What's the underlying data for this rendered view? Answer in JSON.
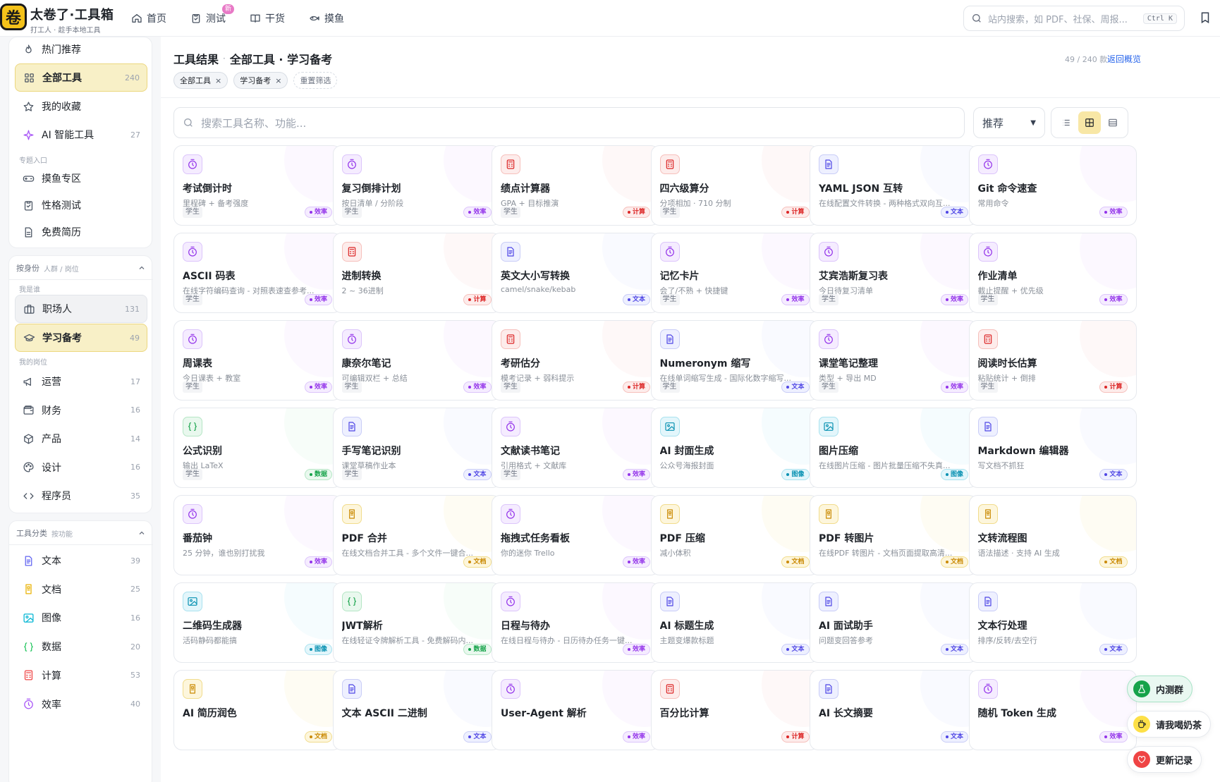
{
  "header": {
    "logo_char": "卷",
    "brand_title": "太卷了·工具箱",
    "brand_sub": "打工人 · 趁手本地工具",
    "nav": [
      {
        "label": "首页",
        "icon": "home-icon"
      },
      {
        "label": "测试",
        "icon": "clipboard-icon",
        "badge": "新"
      },
      {
        "label": "干货",
        "icon": "book-icon"
      },
      {
        "label": "摸鱼",
        "icon": "fish-icon"
      }
    ],
    "search_placeholder": "站内搜索，如 PDF、社保、周报...",
    "search_kbd": "Ctrl K"
  },
  "sidebar": {
    "top_items": [
      {
        "label": "热门推荐",
        "icon": "fire-icon",
        "count": ""
      },
      {
        "label": "全部工具",
        "icon": "grid-icon",
        "count": "240",
        "active": true
      },
      {
        "label": "我的收藏",
        "icon": "star-icon",
        "count": ""
      },
      {
        "label": "AI 智能工具",
        "icon": "sparkle-icon",
        "count": "27"
      }
    ],
    "special_label": "专题入口",
    "special_items": [
      {
        "label": "摸鱼专区",
        "icon": "gamepad-icon"
      },
      {
        "label": "性格测试",
        "icon": "clipboard-icon"
      },
      {
        "label": "免费简历",
        "icon": "document-icon"
      }
    ],
    "identity_head": "按身份",
    "identity_sub": "人群 / 岗位",
    "i_am_label": "我是谁",
    "identity_items": [
      {
        "label": "职场人",
        "icon": "briefcase-icon",
        "count": "131"
      },
      {
        "label": "学习备考",
        "icon": "graduation-icon",
        "count": "49",
        "active": true
      }
    ],
    "role_label": "我的岗位",
    "role_items": [
      {
        "label": "运营",
        "icon": "megaphone-icon",
        "count": "17"
      },
      {
        "label": "财务",
        "icon": "wallet-icon",
        "count": "16"
      },
      {
        "label": "产品",
        "icon": "box-icon",
        "count": "14"
      },
      {
        "label": "设计",
        "icon": "palette-icon",
        "count": "16"
      },
      {
        "label": "程序员",
        "icon": "code-icon",
        "count": "35"
      }
    ],
    "category_head": "工具分类",
    "category_sub": "按功能",
    "category_items": [
      {
        "label": "文本",
        "icon": "text-file-icon",
        "count": "39",
        "color": "#6366f1"
      },
      {
        "label": "文档",
        "icon": "doc-icon",
        "count": "25",
        "color": "#eab308"
      },
      {
        "label": "图像",
        "icon": "image-icon",
        "count": "16",
        "color": "#06b6d4"
      },
      {
        "label": "数据",
        "icon": "braces-icon",
        "count": "20",
        "color": "#22c55e"
      },
      {
        "label": "计算",
        "icon": "calculator-icon",
        "count": "53",
        "color": "#ef4444"
      },
      {
        "label": "效率",
        "icon": "timer-icon",
        "count": "40",
        "color": "#a855f7"
      }
    ]
  },
  "main": {
    "title_a": "工具结果",
    "title_sep": "·",
    "title_b": "全部工具 · 学习备考",
    "counter": "49 / 240 款",
    "back": "返回概览",
    "chips": [
      "全部工具",
      "学习备考"
    ],
    "chip_close": "×",
    "reset": "重置筛选",
    "search_placeholder": "搜索工具名称、功能...",
    "sort": "推荐"
  },
  "colors": {
    "效率": {
      "fg": "#9333ea",
      "bg": "#f5ecff",
      "bd": "#dcc5fb",
      "icon": "timer-icon"
    },
    "计算": {
      "fg": "#dc2626",
      "bg": "#fdeceb",
      "bd": "#f6c0bc",
      "icon": "calculator-icon"
    },
    "文本": {
      "fg": "#4f46e5",
      "bg": "#eef0ff",
      "bd": "#c9cdf7",
      "icon": "text-file-icon"
    },
    "数据": {
      "fg": "#16a34a",
      "bg": "#e9f8ee",
      "bd": "#b5e6c5",
      "icon": "braces-icon"
    },
    "图像": {
      "fg": "#0891b2",
      "bg": "#e3f6fb",
      "bd": "#a9e2ef",
      "icon": "image-icon"
    },
    "文档": {
      "fg": "#ca8a04",
      "bg": "#fdf6dc",
      "bd": "#f1dc8c",
      "icon": "doc-icon"
    }
  },
  "tools": [
    {
      "name": "考试倒计时",
      "desc": "里程碑 + 备考强度",
      "aud": "学生",
      "tag": "效率"
    },
    {
      "name": "复习倒排计划",
      "desc": "按日清单 / 分阶段",
      "aud": "学生",
      "tag": "效率"
    },
    {
      "name": "绩点计算器",
      "desc": "GPA + 目标推演",
      "aud": "学生",
      "tag": "计算"
    },
    {
      "name": "四六级算分",
      "desc": "分项相加 · 710 分制",
      "aud": "学生",
      "tag": "计算"
    },
    {
      "name": "YAML JSON 互转",
      "desc": "在线配置文件转换 - 两种格式双向互...",
      "aud": "",
      "tag": "文本"
    },
    {
      "name": "Git 命令速查",
      "desc": "常用命令",
      "aud": "",
      "tag": "效率"
    },
    {
      "name": "ASCII 码表",
      "desc": "在线字符编码查询 - 对照表速查参考...",
      "aud": "学生",
      "tag": "效率"
    },
    {
      "name": "进制转换",
      "desc": "2 ~ 36进制",
      "aud": "",
      "tag": "计算"
    },
    {
      "name": "英文大小写转换",
      "desc": "camel/snake/kebab",
      "aud": "",
      "tag": "文本"
    },
    {
      "name": "记忆卡片",
      "desc": "会了/不熟 + 快捷键",
      "aud": "学生",
      "tag": "效率"
    },
    {
      "name": "艾宾浩斯复习表",
      "desc": "今日待复习清单",
      "aud": "学生",
      "tag": "效率"
    },
    {
      "name": "作业清单",
      "desc": "截止提醒 + 优先级",
      "aud": "学生",
      "tag": "效率"
    },
    {
      "name": "周课表",
      "desc": "今日课表 + 教室",
      "aud": "学生",
      "tag": "效率"
    },
    {
      "name": "康奈尔笔记",
      "desc": "可编辑双栏 + 总结",
      "aud": "学生",
      "tag": "效率"
    },
    {
      "name": "考研估分",
      "desc": "模考记录 + 弱科提示",
      "aud": "学生",
      "tag": "计算"
    },
    {
      "name": "Numeronym 缩写",
      "desc": "在线单词缩写生成 - 国际化数字缩写...",
      "aud": "学生",
      "tag": "文本"
    },
    {
      "name": "课堂笔记整理",
      "desc": "类型 + 导出 MD",
      "aud": "学生",
      "tag": "效率"
    },
    {
      "name": "阅读时长估算",
      "desc": "粘贴统计 + 倒排",
      "aud": "学生",
      "tag": "计算"
    },
    {
      "name": "公式识别",
      "desc": "输出 LaTeX",
      "aud": "学生",
      "tag": "数据"
    },
    {
      "name": "手写笔记识别",
      "desc": "课堂草稿作业本",
      "aud": "学生",
      "tag": "文本"
    },
    {
      "name": "文献读书笔记",
      "desc": "引用格式 + 文献库",
      "aud": "学生",
      "tag": "效率"
    },
    {
      "name": "AI 封面生成",
      "desc": "公众号海报封面",
      "aud": "",
      "tag": "图像"
    },
    {
      "name": "图片压缩",
      "desc": "在线图片压缩 - 图片批量压缩不失真...",
      "aud": "",
      "tag": "图像"
    },
    {
      "name": "Markdown 编辑器",
      "desc": "写文档不抓狂",
      "aud": "",
      "tag": "文本"
    },
    {
      "name": "番茄钟",
      "desc": "25 分钟，谁也别打扰我",
      "aud": "",
      "tag": "效率"
    },
    {
      "name": "PDF 合并",
      "desc": "在线文档合并工具 - 多个文件一键合...",
      "aud": "",
      "tag": "文档"
    },
    {
      "name": "拖拽式任务看板",
      "desc": "你的迷你 Trello",
      "aud": "",
      "tag": "效率"
    },
    {
      "name": "PDF 压缩",
      "desc": "减小体积",
      "aud": "",
      "tag": "文档"
    },
    {
      "name": "PDF 转图片",
      "desc": "在线PDF 转图片 - 文档页面提取高清...",
      "aud": "",
      "tag": "文档"
    },
    {
      "name": "文转流程图",
      "desc": "语法描述 · 支持 AI 生成",
      "aud": "",
      "tag": "文档"
    },
    {
      "name": "二维码生成器",
      "desc": "活码静码都能搞",
      "aud": "",
      "tag": "图像"
    },
    {
      "name": "JWT解析",
      "desc": "在线轻证令牌解析工具 - 免费解码内...",
      "aud": "",
      "tag": "数据"
    },
    {
      "name": "日程与待办",
      "desc": "在线日程与待办 - 日历待办任务一键...",
      "aud": "",
      "tag": "效率"
    },
    {
      "name": "AI 标题生成",
      "desc": "主题变爆款标题",
      "aud": "",
      "tag": "文本"
    },
    {
      "name": "AI 面试助手",
      "desc": "问题变回答参考",
      "aud": "",
      "tag": "文本"
    },
    {
      "name": "文本行处理",
      "desc": "排序/反转/去空行",
      "aud": "",
      "tag": "文本"
    },
    {
      "name": "AI 简历润色",
      "desc": "",
      "aud": "",
      "tag": "文档"
    },
    {
      "name": "文本 ASCII 二进制",
      "desc": "",
      "aud": "",
      "tag": "文本"
    },
    {
      "name": "User-Agent 解析",
      "desc": "",
      "aud": "",
      "tag": "效率"
    },
    {
      "name": "百分比计算",
      "desc": "",
      "aud": "",
      "tag": "计算"
    },
    {
      "name": "AI 长文摘要",
      "desc": "",
      "aud": "",
      "tag": "文本"
    },
    {
      "name": "随机 Token 生成",
      "desc": "",
      "aud": "",
      "tag": "效率"
    }
  ],
  "floats": [
    {
      "label": "内测群",
      "icon": "flask-icon"
    },
    {
      "label": "请我喝奶茶",
      "icon": "cup-icon"
    },
    {
      "label": "更新记录",
      "icon": "heart-icon"
    }
  ]
}
